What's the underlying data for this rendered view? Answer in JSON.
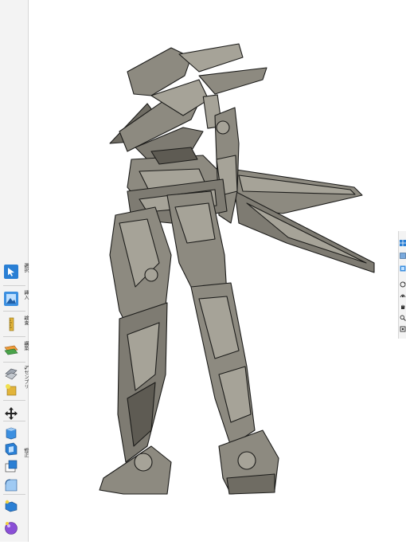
{
  "left_toolbar": {
    "tools": [
      {
        "name": "select-tool",
        "label": "選択"
      },
      {
        "name": "insert-tool",
        "label": "挿入"
      },
      {
        "name": "measure-tool",
        "label": "検査"
      },
      {
        "name": "construct-tool",
        "label": "構築"
      },
      {
        "name": "assemble-tool",
        "label": "アセンブリ"
      },
      {
        "name": "move-tool",
        "label": ""
      },
      {
        "name": "modify-tool",
        "label": "修正"
      }
    ]
  },
  "colors": {
    "toolbar_bg": "#f3f3f3",
    "accent_blue": "#2a7fd4",
    "model_body": "#8d8a80",
    "model_dark": "#5e5b53",
    "model_light": "#a6a398",
    "outline": "#1c1c1a"
  }
}
